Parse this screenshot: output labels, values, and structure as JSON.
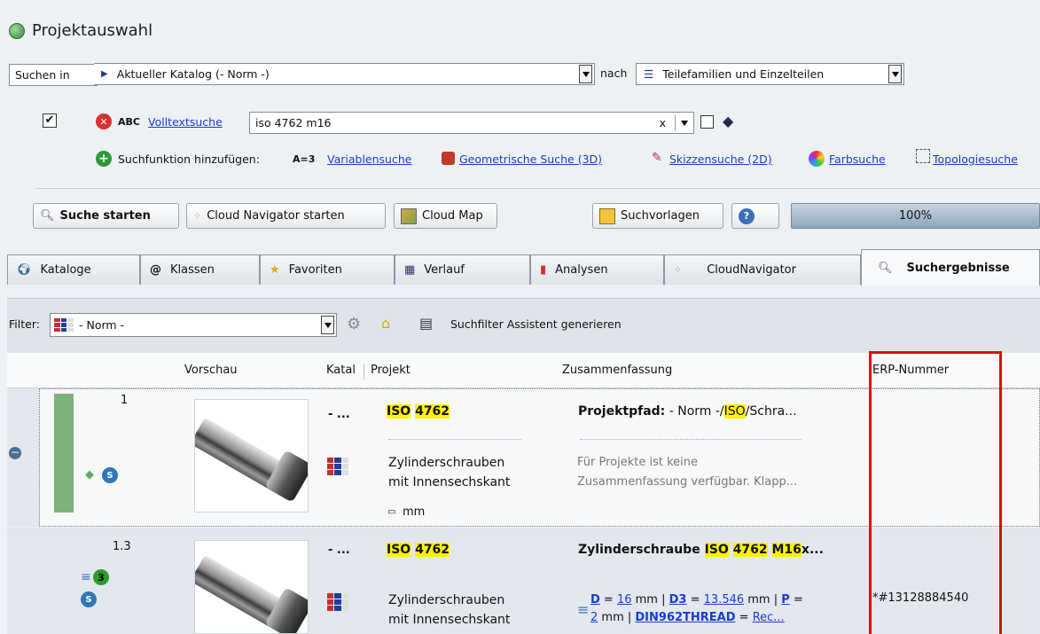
{
  "window": {
    "title": "Projektauswahl"
  },
  "search": {
    "in_label": "Suchen in",
    "catalog_value": "Aktueller Katalog (- Norm -)",
    "nach_label": "nach",
    "type_value": "Teilefamilien und Einzelteilen"
  },
  "fulltext": {
    "abc": "ABC",
    "link": "Volltextsuche",
    "value": "iso 4762 m16",
    "clear": "x"
  },
  "addfn": {
    "label": "Suchfunktion hinzufügen:",
    "var_prefix": "A=3",
    "var_link": "Variablensuche",
    "geo_link": "Geometrische Suche (3D)",
    "sketch_link": "Skizzensuche (2D)",
    "color_link": "Farbsuche",
    "topo_link": "Topologiesuche"
  },
  "toolbar": {
    "start": "Suche starten",
    "cloudnav": "Cloud Navigator starten",
    "cloudmap": "Cloud Map",
    "templates": "Suchvorlagen",
    "progress": "100%"
  },
  "tabs": [
    "Kataloge",
    "Klassen",
    "Favoriten",
    "Verlauf",
    "Analysen",
    "CloudNavigator",
    "Suchergebnisse"
  ],
  "filter": {
    "label": "Filter:",
    "value": "- Norm -",
    "assistant": "Suchfilter Assistent generieren"
  },
  "columns": [
    "Vorschau",
    "Katal",
    "Projekt",
    "Zusammenfassung",
    "ERP-Nummer"
  ],
  "rows": [
    {
      "index": "1",
      "catalog": "- ...",
      "project_a": "ISO",
      "project_b": "4762",
      "desc1": "Zylinderschrauben",
      "desc2": "mit Innensechskant",
      "unit": "mm",
      "sum_label": "Projektpfad:",
      "sum_pre": " - Norm -/",
      "sum_hl": "ISO",
      "sum_post": "/Schra...",
      "info1": "Für Projekte ist keine",
      "info2": "Zusammenfassung verfügbar. Klapp...",
      "erp": ""
    },
    {
      "index": "1.3",
      "catalog": "- ...",
      "project_a": "ISO",
      "project_b": "4762",
      "desc1": "Zylinderschrauben",
      "desc2": "mit Innensechskant",
      "title_pre": "Zylinderschraube ",
      "title_hl1": "ISO",
      "title_hl2": "4762",
      "title_hl3": "M16",
      "title_post": "x...",
      "p_d": "D",
      "p_d_val": "16",
      "p_d3": "D3",
      "p_d3_val": "13.546",
      "p_p": "P",
      "p_p_val": "2",
      "p_thread": "DIN962THREAD",
      "p_rec": "Rec...",
      "eq": " = ",
      "unit_sep": " mm | ",
      "unit_tail": " =",
      "badge": "3",
      "erp": "*#13128884540"
    }
  ]
}
